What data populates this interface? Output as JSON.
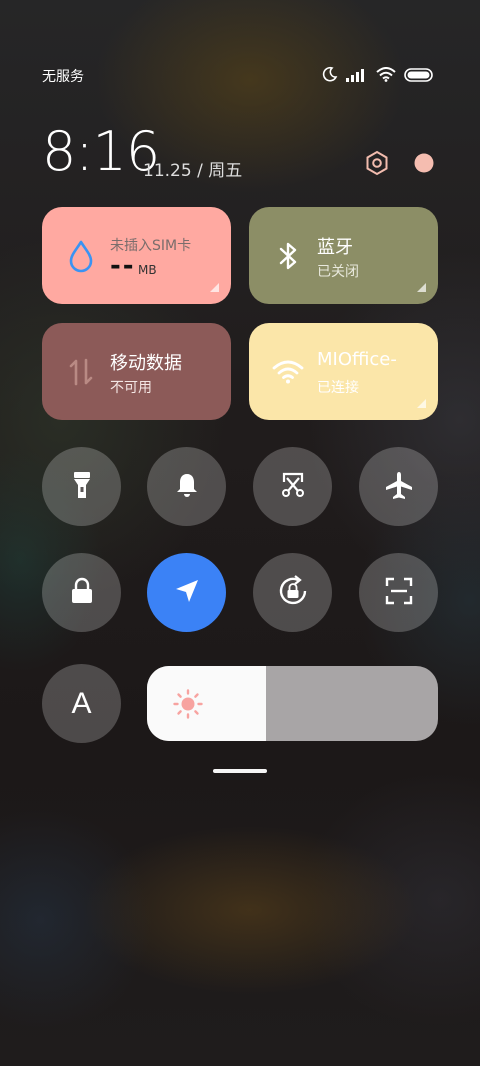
{
  "status_bar": {
    "carrier": "无服务",
    "icons": [
      "moon-icon",
      "signal-icon",
      "wifi-icon",
      "battery-icon"
    ]
  },
  "header": {
    "time": "8:16",
    "date": "11.25 / 周五",
    "icons": [
      "settings-icon",
      "profile-dot-icon"
    ]
  },
  "tiles": {
    "data_usage": {
      "title": "未插入SIM卡",
      "value": "--",
      "unit": "MB",
      "color": "#ffa9a1"
    },
    "bluetooth": {
      "title": "蓝牙",
      "status": "已关闭",
      "color": "#8c8e66"
    },
    "mobile_data": {
      "title": "移动数据",
      "status": "不可用",
      "color": "#8c5a58"
    },
    "wifi": {
      "title": "MIOffice-",
      "status": "已连接",
      "color": "#fbe6a9"
    }
  },
  "toggles": [
    {
      "name": "flashlight-toggle",
      "icon": "flashlight-icon",
      "active": false
    },
    {
      "name": "mute-toggle",
      "icon": "bell-icon",
      "active": false
    },
    {
      "name": "screenshot-toggle",
      "icon": "scissors-icon",
      "active": false
    },
    {
      "name": "airplane-toggle",
      "icon": "airplane-icon",
      "active": false
    },
    {
      "name": "lock-screen-toggle",
      "icon": "lock-icon",
      "active": false
    },
    {
      "name": "location-toggle",
      "icon": "location-arrow-icon",
      "active": true
    },
    {
      "name": "rotation-lock-toggle",
      "icon": "rotation-lock-icon",
      "active": false
    },
    {
      "name": "scanner-toggle",
      "icon": "scan-icon",
      "active": false
    },
    {
      "name": "auto-brightness-toggle",
      "icon": "letter-a-icon",
      "label": "A",
      "active": false
    }
  ],
  "brightness": {
    "level": 0.41,
    "icon": "sun-icon"
  },
  "colors": {
    "accent_blue": "#3b82f6",
    "sun": "#f7a3a0",
    "water_drop": "#3a93f3"
  }
}
